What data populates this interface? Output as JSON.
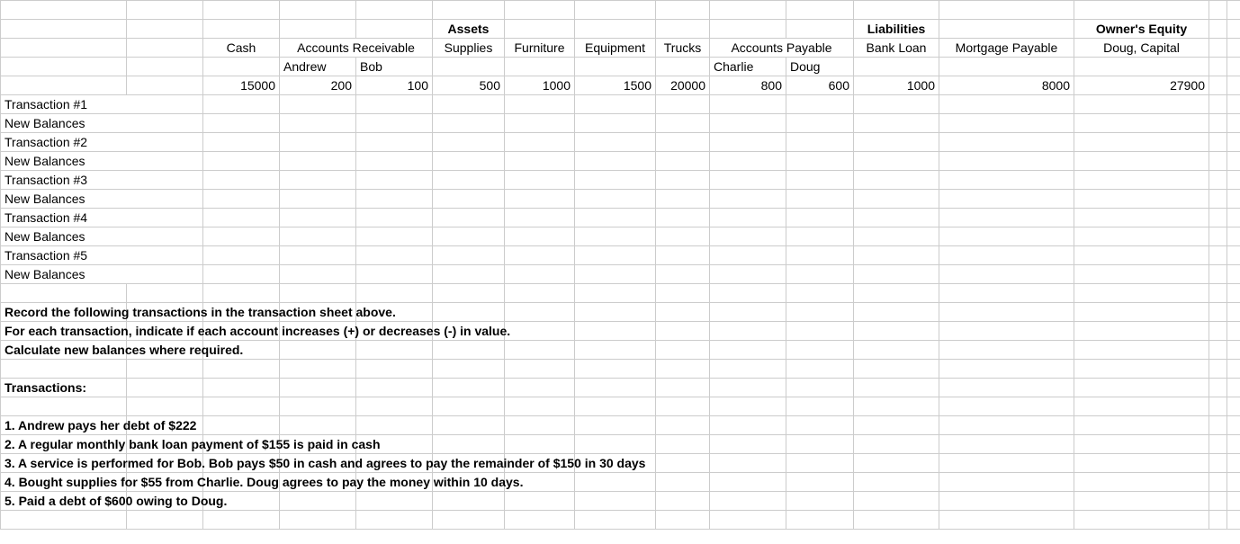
{
  "sections": {
    "assets": "Assets",
    "liabilities": "Liabilities",
    "owners_equity": "Owner's Equity"
  },
  "headers": {
    "cash": "Cash",
    "ar": "Accounts Receivable",
    "supplies": "Supplies",
    "furniture": "Furniture",
    "equipment": "Equipment",
    "trucks": "Trucks",
    "ap": "Accounts Payable",
    "bank_loan": "Bank Loan",
    "mortgage": "Mortgage Payable",
    "capital": "Doug, Capital"
  },
  "sub": {
    "andrew": "Andrew",
    "bob": "Bob",
    "charlie": "Charlie",
    "doug": "Doug"
  },
  "values": {
    "cash": "15000",
    "ar_andrew": "200",
    "ar_bob": "100",
    "supplies": "500",
    "furniture": "1000",
    "equipment": "1500",
    "trucks": "20000",
    "ap_charlie": "800",
    "ap_doug": "600",
    "bank_loan": "1000",
    "mortgage": "8000",
    "capital": "27900"
  },
  "rows": {
    "t1": "Transaction #1",
    "nb1": "New Balances",
    "t2": "Transaction #2",
    "nb2": "New Balances",
    "t3": "Transaction #3",
    "nb3": "New Balances",
    "t4": "Transaction #4",
    "nb4": "New Balances",
    "t5": "Transaction #5",
    "nb5": "New Balances"
  },
  "instructions": {
    "line1": "Record the following transactions in the transaction sheet above.",
    "line2": "For each transaction, indicate if each account increases (+) or decreases (-) in value.",
    "line3": "Calculate new balances where required.",
    "heading": "Transactions:",
    "item1": "1. Andrew pays her debt of $222",
    "item2": "2. A regular monthly bank loan payment of $155 is paid in cash",
    "item3": "3. A service is performed for Bob. Bob pays $50 in cash and agrees to pay the remainder of $150 in 30 days",
    "item4": "4. Bought supplies for $55 from Charlie. Doug agrees to pay the money within 10 days.",
    "item5": "5. Paid a debt of $600 owing to Doug."
  }
}
